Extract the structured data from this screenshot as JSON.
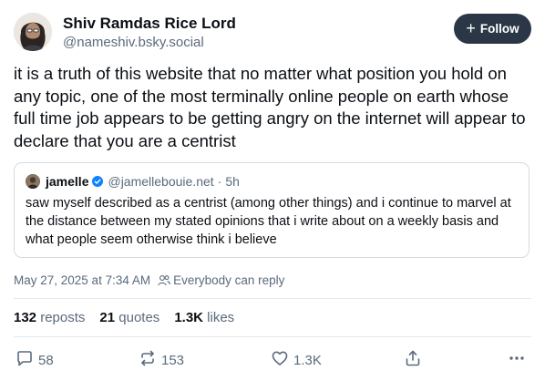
{
  "author": {
    "name": "Shiv Ramdas Rice Lord",
    "handle": "@nameshiv.bsky.social"
  },
  "follow_button": {
    "label": "Follow"
  },
  "post": {
    "text": "it is a truth of this website that no matter what position you hold on any topic, one of the most terminally online people on earth whose full time job appears to be getting angry on the internet will appear to declare that you are a centrist"
  },
  "quote": {
    "name": "jamelle",
    "handle": "@jamellebouie.net",
    "separator": "·",
    "time": "5h",
    "text": "saw myself described as a centrist (among other things) and i continue to marvel at the distance between my stated opinions that i write about on a weekly basis and what people seem otherwise think i believe"
  },
  "meta": {
    "timestamp": "May 27, 2025 at 7:34 AM",
    "reply_setting": "Everybody can reply"
  },
  "stats": {
    "reposts_count": "132",
    "reposts_label": "reposts",
    "quotes_count": "21",
    "quotes_label": "quotes",
    "likes_count": "1.3K",
    "likes_label": "likes"
  },
  "actions": {
    "reply_count": "58",
    "repost_count": "153",
    "like_count": "1.3K"
  },
  "colors": {
    "follow_bg": "#2b3746",
    "verified": "#1083fe",
    "muted_text": "#5b6b7c",
    "divider": "#e4e9ee"
  }
}
